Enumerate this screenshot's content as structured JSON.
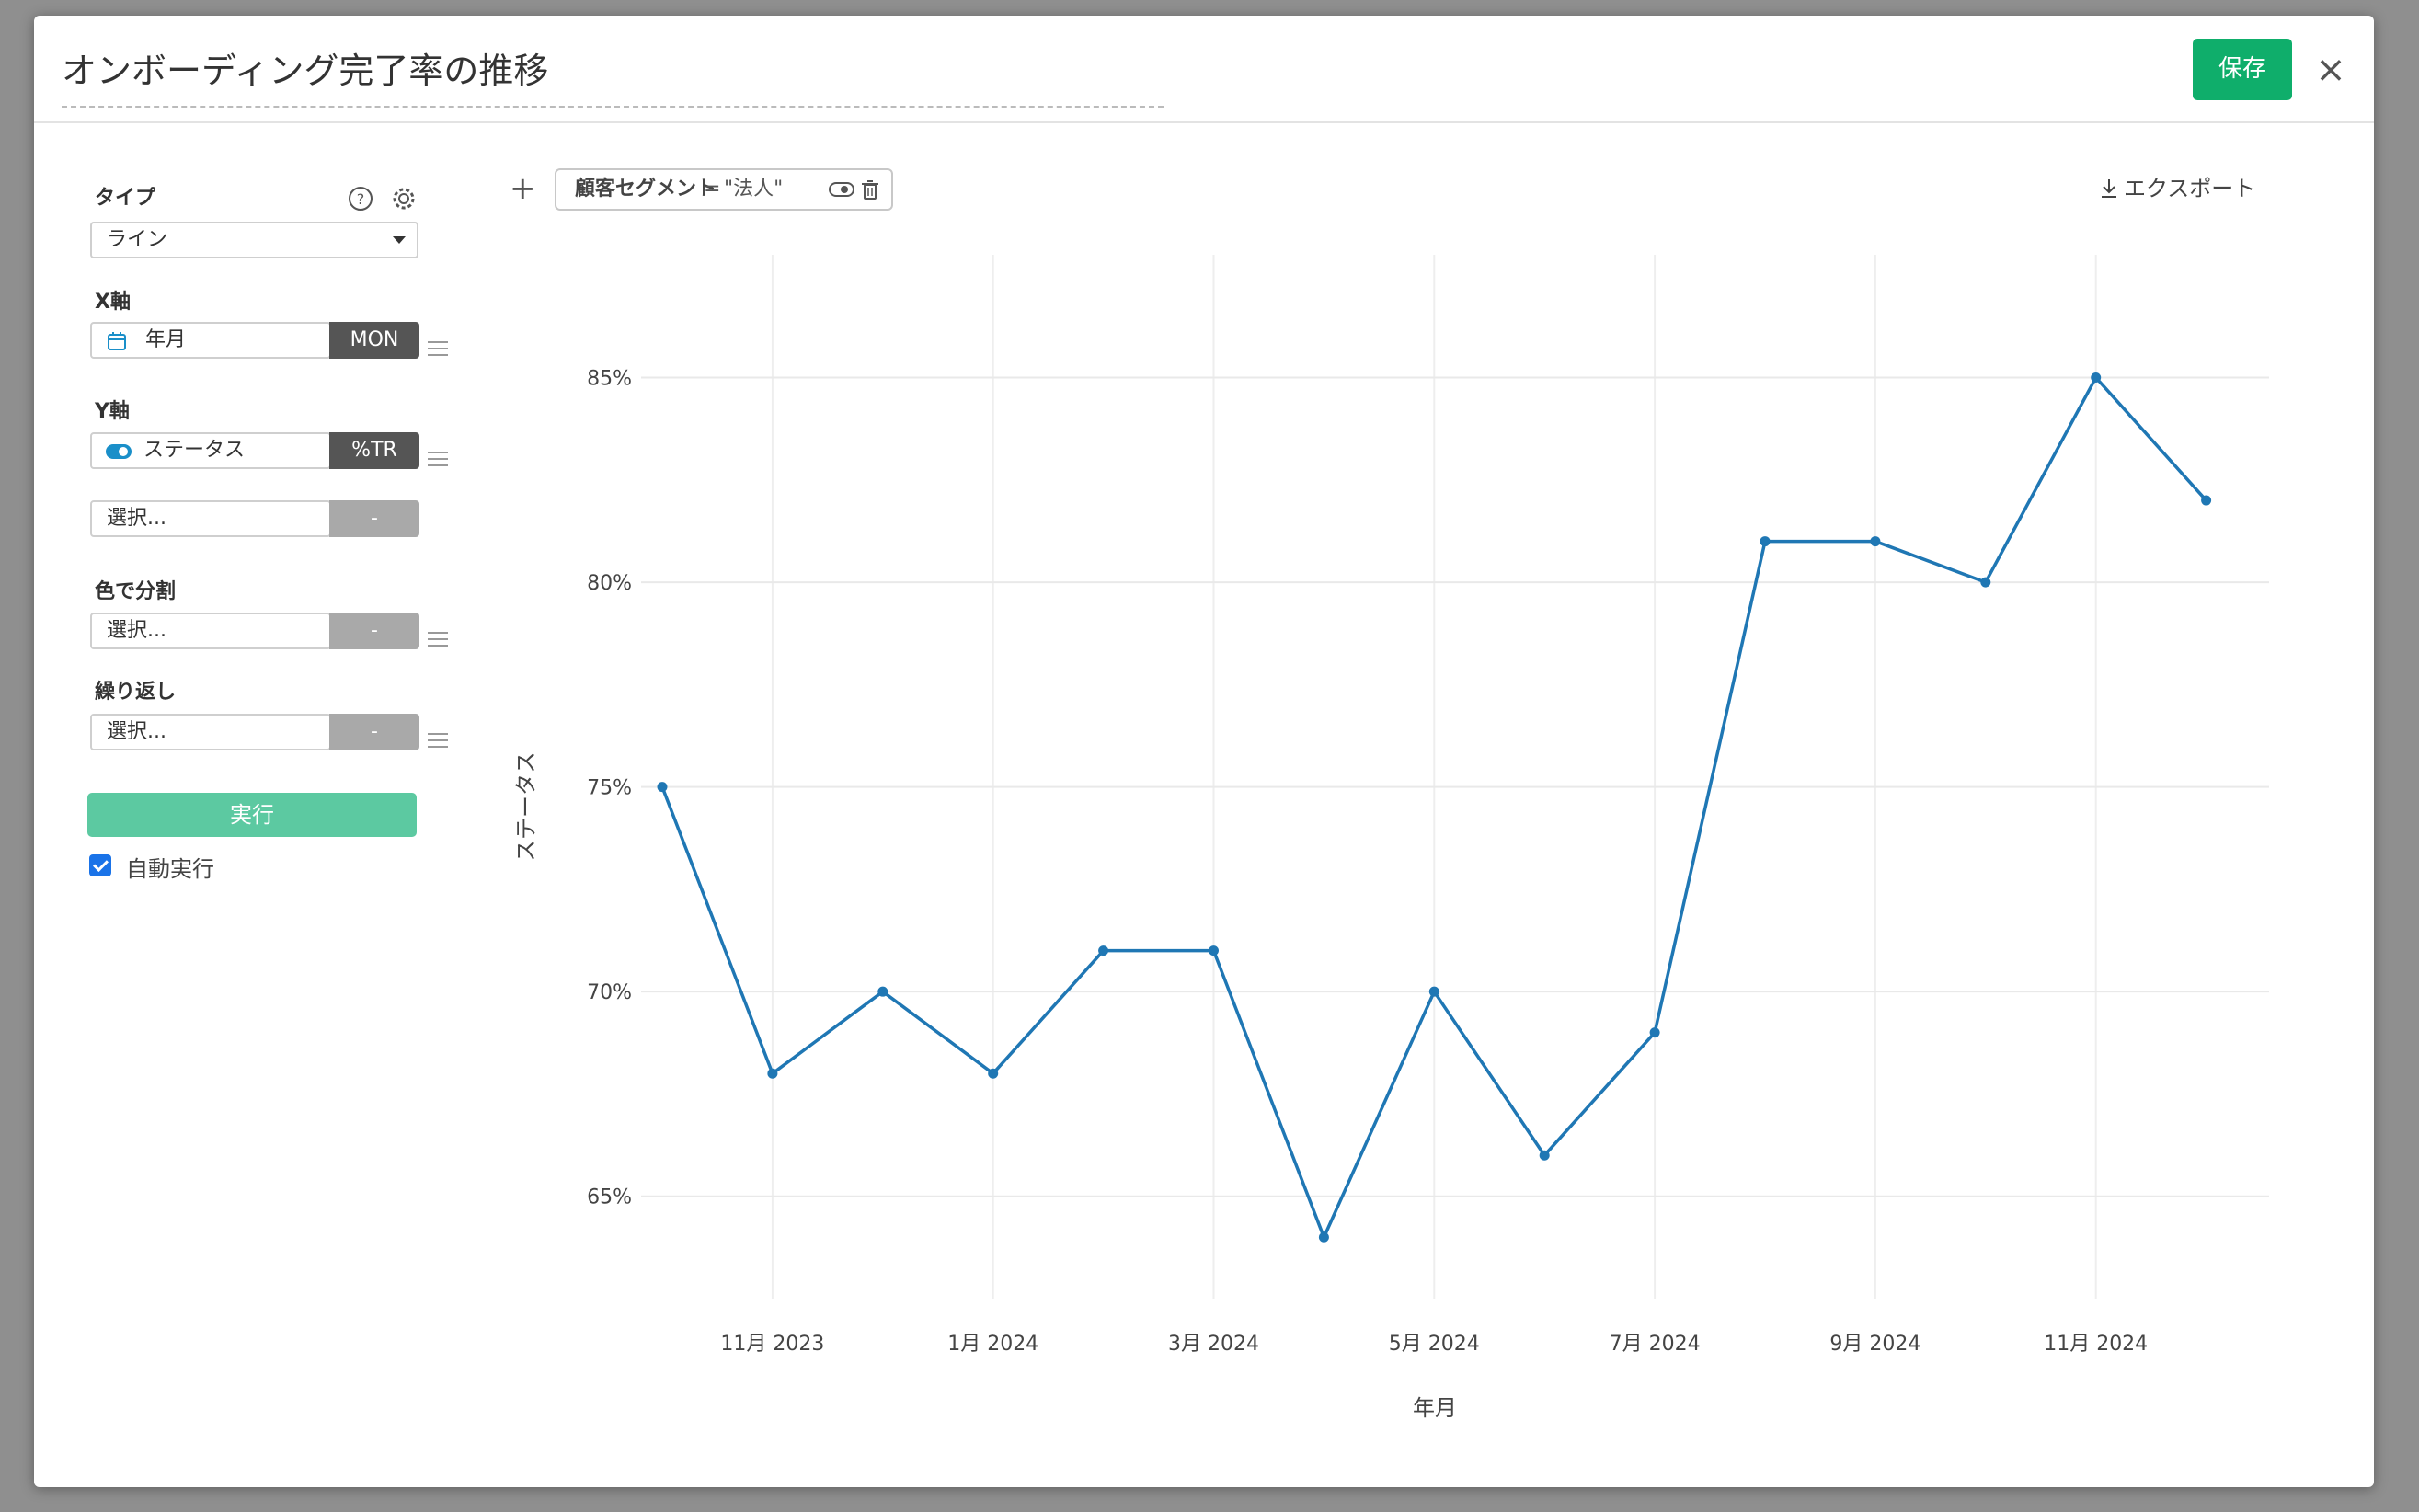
{
  "header": {
    "title": "オンボーディング完了率の推移",
    "save_label": "保存",
    "close_label": "×"
  },
  "sidebar": {
    "type_label": "タイプ",
    "type_value": "ライン",
    "x_label": "X軸",
    "x_field": "年月",
    "x_tag": "MON",
    "y_label": "Y軸",
    "y_field": "ステータス",
    "y_tag": "%TR",
    "y2_placeholder": "選択...",
    "y2_tag": "-",
    "color_label": "色で分割",
    "color_placeholder": "選択...",
    "color_tag": "-",
    "repeat_label": "繰り返し",
    "repeat_placeholder": "選択...",
    "repeat_tag": "-",
    "run_label": "実行",
    "auto_run_label": "自動実行"
  },
  "filterbar": {
    "add_label": "+",
    "filter_field": "顧客セグメント",
    "filter_op": "=",
    "filter_value": "\"法人\"",
    "export_label": "エクスポート"
  },
  "colors": {
    "accent": "#0fae6b",
    "run_button": "#5cc9a1",
    "line": "#1f77b4"
  },
  "chart_data": {
    "type": "line",
    "xlabel": "年月",
    "ylabel": "ステータス",
    "x": [
      "2023-10",
      "2023-11",
      "2023-12",
      "2024-01",
      "2024-02",
      "2024-03",
      "2024-04",
      "2024-05",
      "2024-06",
      "2024-07",
      "2024-08",
      "2024-09",
      "2024-10",
      "2024-11",
      "2024-12"
    ],
    "x_tick_labels": [
      "11月 2023",
      "1月 2024",
      "3月 2024",
      "5月 2024",
      "7月 2024",
      "9月 2024",
      "11月 2024"
    ],
    "x_tick_positions": [
      "2023-11",
      "2024-01",
      "2024-03",
      "2024-05",
      "2024-07",
      "2024-09",
      "2024-11"
    ],
    "y_tick_labels": [
      "65%",
      "70%",
      "75%",
      "80%",
      "85%"
    ],
    "y_ticks": [
      65,
      70,
      75,
      80,
      85
    ],
    "ylim": [
      62.5,
      88
    ],
    "series": [
      {
        "values": [
          75,
          68,
          70,
          68,
          71,
          71,
          64,
          70,
          66,
          69,
          81,
          81,
          80,
          85,
          82
        ]
      }
    ],
    "grid": true
  }
}
